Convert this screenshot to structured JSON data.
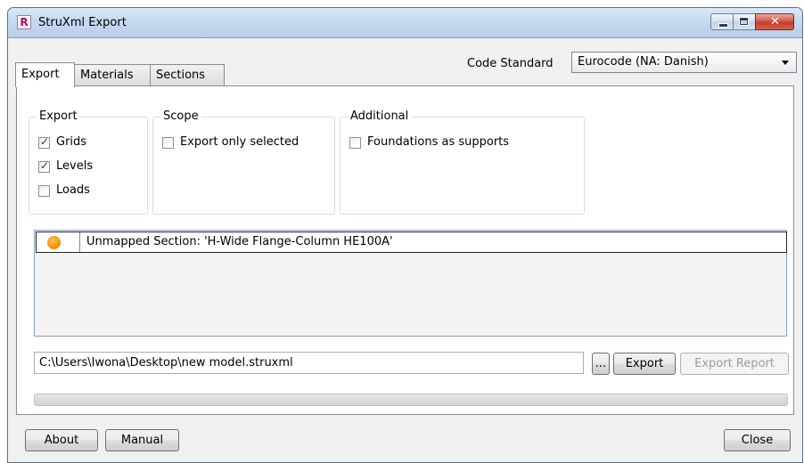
{
  "window": {
    "title": "StruXml Export",
    "app_icon_letter": "R",
    "controls": {
      "minimize": "minimize-icon",
      "maximize": "maximize-icon",
      "close": "close-icon"
    }
  },
  "tabs": [
    {
      "label": "Export",
      "active": true
    },
    {
      "label": "Materials",
      "active": false
    },
    {
      "label": "Sections",
      "active": false
    }
  ],
  "code_standard": {
    "label": "Code Standard",
    "selected": "Eurocode (NA: Danish)"
  },
  "groups": {
    "export": {
      "title": "Export",
      "items": [
        {
          "label": "Grids",
          "checked": true
        },
        {
          "label": "Levels",
          "checked": true
        },
        {
          "label": "Loads",
          "checked": false
        }
      ]
    },
    "scope": {
      "title": "Scope",
      "items": [
        {
          "label": "Export only selected",
          "checked": false
        }
      ]
    },
    "additional": {
      "title": "Additional",
      "items": [
        {
          "label": "Foundations as supports",
          "checked": false
        }
      ]
    }
  },
  "report": {
    "rows": [
      {
        "status": "warning",
        "status_color": "#f28c00",
        "text": "Unmapped Section: 'H-Wide Flange-Column HE100A'"
      }
    ]
  },
  "file": {
    "path": "C:\\Users\\Iwona\\Desktop\\new model.struxml",
    "browse_label": "...",
    "export_label": "Export",
    "export_report_label": "Export Report",
    "export_report_enabled": false
  },
  "progress": {
    "value": 0
  },
  "footer": {
    "about_label": "About",
    "manual_label": "Manual",
    "close_label": "Close"
  },
  "colors": {
    "titlebar": "#c5d9ef",
    "close_button": "#c23b2c",
    "status_warning": "#f28c00"
  }
}
